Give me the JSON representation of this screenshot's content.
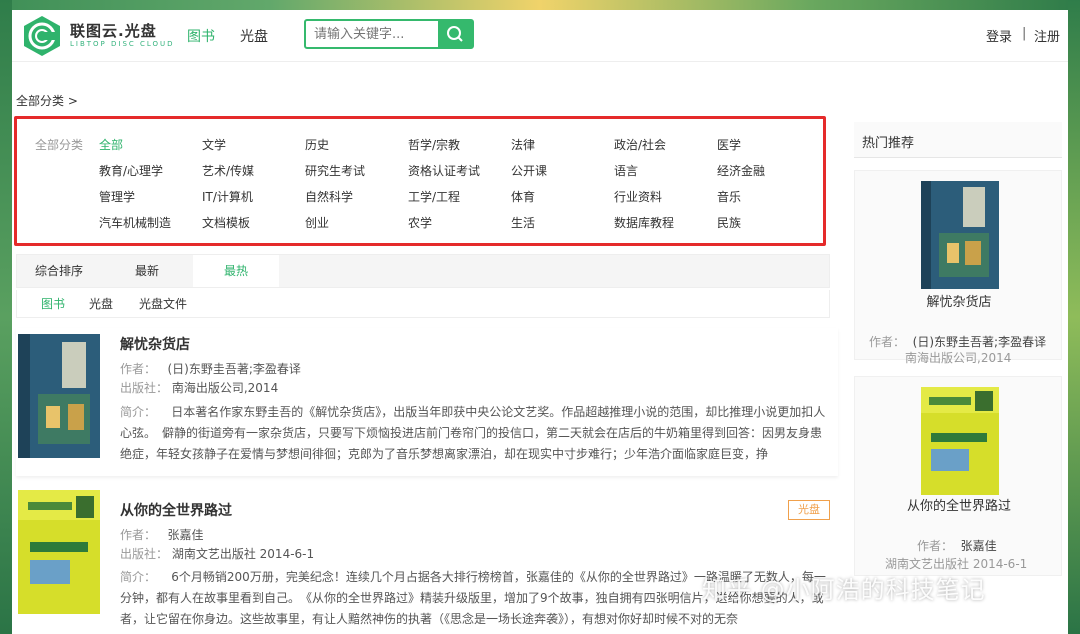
{
  "header": {
    "logo_text": "联图云.光盘",
    "logo_sub": "LIBTOP DISC CLOUD",
    "nav": [
      {
        "label": "图书",
        "active": true
      },
      {
        "label": "光盘",
        "active": false
      }
    ],
    "search_placeholder": "请输入关键字...",
    "login": "登录",
    "sep": "|",
    "register": "注册"
  },
  "breadcrumb": "全部分类  >",
  "categories": {
    "label": "全部分类",
    "rows": [
      [
        "全部",
        "文学",
        "历史",
        "哲学/宗教",
        "法律",
        "政治/社会",
        "医学"
      ],
      [
        "教育/心理学",
        "艺术/传媒",
        "研究生考试",
        "资格认证考试",
        "公开课",
        "语言",
        "经济金融"
      ],
      [
        "管理学",
        "IT/计算机",
        "自然科学",
        "工学/工程",
        "体育",
        "行业资料",
        "音乐"
      ],
      [
        "汽车机械制造",
        "文档模板",
        "创业",
        "农学",
        "生活",
        "数据库教程",
        "民族"
      ]
    ],
    "active": "全部"
  },
  "sort_tabs": [
    {
      "label": "综合排序",
      "active": false
    },
    {
      "label": "最新",
      "active": false
    },
    {
      "label": "最热",
      "active": true
    }
  ],
  "type_tabs": [
    {
      "label": "图书",
      "active": true
    },
    {
      "label": "光盘",
      "active": false
    },
    {
      "label": "光盘文件",
      "active": false
    }
  ],
  "results": [
    {
      "title": "解忧杂货店",
      "author_label": "作者：",
      "author": "(日)东野圭吾著;李盈春译",
      "publisher_label": "出版社：",
      "publisher": "南海出版公司,2014",
      "desc_label": "简介：",
      "desc": "日本著名作家东野圭吾的《解忧杂货店》，出版当年即获中央公论文艺奖。作品超越推理小说的范围，却比推理小说更加扣人心弦。　僻静的街道旁有一家杂货店，只要写下烦恼投进店前门卷帘门的投信口，第二天就会在店后的牛奶箱里得到回答：因男友身患绝症，年轻女孩静子在爱情与梦想间徘徊；克郎为了音乐梦想离家漂泊，却在现实中寸步难行；少年浩介面临家庭巨变，挣",
      "tag": "",
      "cover_color": "#2c5d7a"
    },
    {
      "title": "从你的全世界路过",
      "author_label": "作者：",
      "author": "张嘉佳",
      "publisher_label": "出版社：",
      "publisher": "湖南文艺出版社 2014-6-1",
      "desc_label": "简介：",
      "desc": "6个月畅销200万册，完美纪念！连续几个月占据各大排行榜榜首，张嘉佳的《从你的全世界路过》一路温暖了无数人，每一分钟，都有人在故事里看到自己。　《从你的全世界路过》精装升级版里，增加了9个故事，独自拥有四张明信片，送给你想要的人，或者，让它留在你身边。这些故事里，有让人黯然神伤的执著（《思念是一场长途奔袭》），有想对你好却时候不对的无奈",
      "tag": "光盘",
      "cover_color": "#d6de2a"
    }
  ],
  "sidebar": {
    "title": "热门推荐",
    "items": [
      {
        "name": "解忧杂货店",
        "author_label": "作者：",
        "author": "(日)东野圭吾著;李盈春译",
        "publisher": "南海出版公司,2014"
      },
      {
        "name": "从你的全世界路过",
        "author_label": "作者：",
        "author": "张嘉佳",
        "publisher": "湖南文艺出版社 2014-6-1"
      }
    ]
  },
  "watermark": "知乎 @小阿浩的科技笔记",
  "colors": {
    "accent": "#2fb36c",
    "highlight_border": "#e52a2a",
    "tag": "#f0a04b"
  }
}
